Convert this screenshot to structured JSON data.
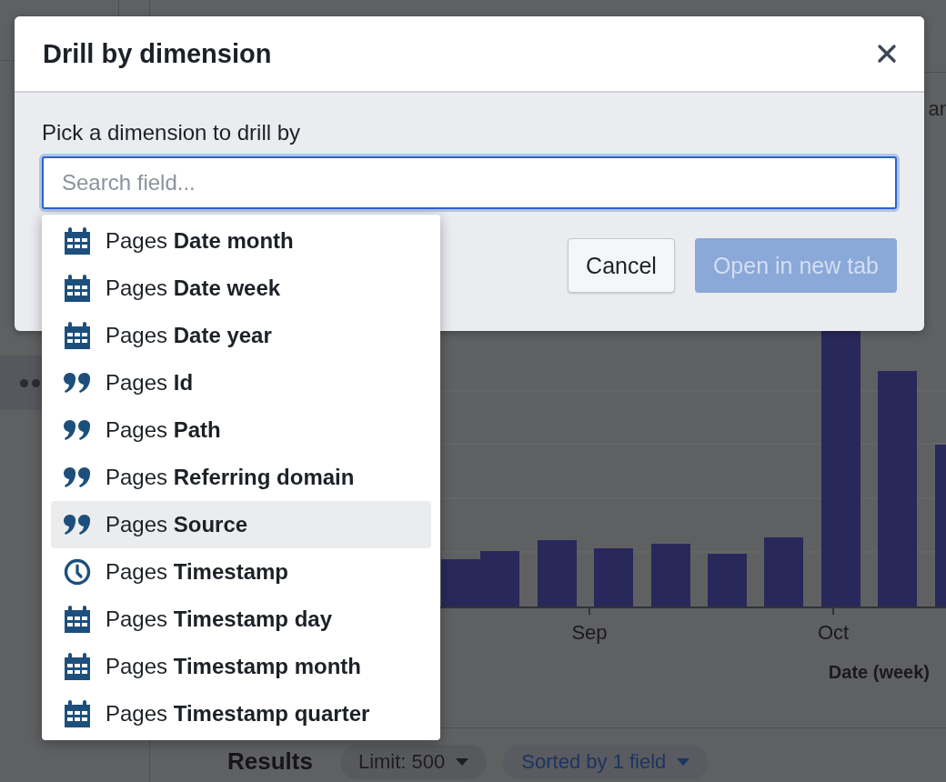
{
  "background": {
    "header_fragment": "ar",
    "chart": {
      "x_labels": [
        "Sep",
        "Oct"
      ],
      "axis_title": "Date (week)"
    },
    "results": {
      "title": "Results",
      "limit": "Limit: 500",
      "sort": "Sorted by 1 field"
    }
  },
  "dialog": {
    "title": "Drill by dimension",
    "label": "Pick a dimension to drill by",
    "search": {
      "placeholder": "Search field..."
    },
    "options": [
      {
        "kind": "date",
        "text": "Pages **Date month**",
        "selected": false
      },
      {
        "kind": "date",
        "text": "Pages **Date week**",
        "selected": false
      },
      {
        "kind": "date",
        "text": "Pages **Date year**",
        "selected": false
      },
      {
        "kind": "string",
        "text": "Pages **Id**",
        "selected": false
      },
      {
        "kind": "string",
        "text": "Pages **Path**",
        "selected": false
      },
      {
        "kind": "string",
        "text": "Pages **Referring domain**",
        "selected": false
      },
      {
        "kind": "string",
        "text": "Pages **Source**",
        "selected": true
      },
      {
        "kind": "time",
        "text": "Pages **Timestamp**",
        "selected": false
      },
      {
        "kind": "date",
        "text": "Pages **Timestamp day**",
        "selected": false
      },
      {
        "kind": "date",
        "text": "Pages **Timestamp month**",
        "selected": false
      },
      {
        "kind": "date",
        "text": "Pages **Timestamp quarter**",
        "selected": false
      }
    ],
    "buttons": [
      {
        "label": "Cancel",
        "kind": "secondary",
        "disabled": false
      },
      {
        "label": "Open in new tab",
        "kind": "primary",
        "disabled": true
      }
    ]
  }
}
